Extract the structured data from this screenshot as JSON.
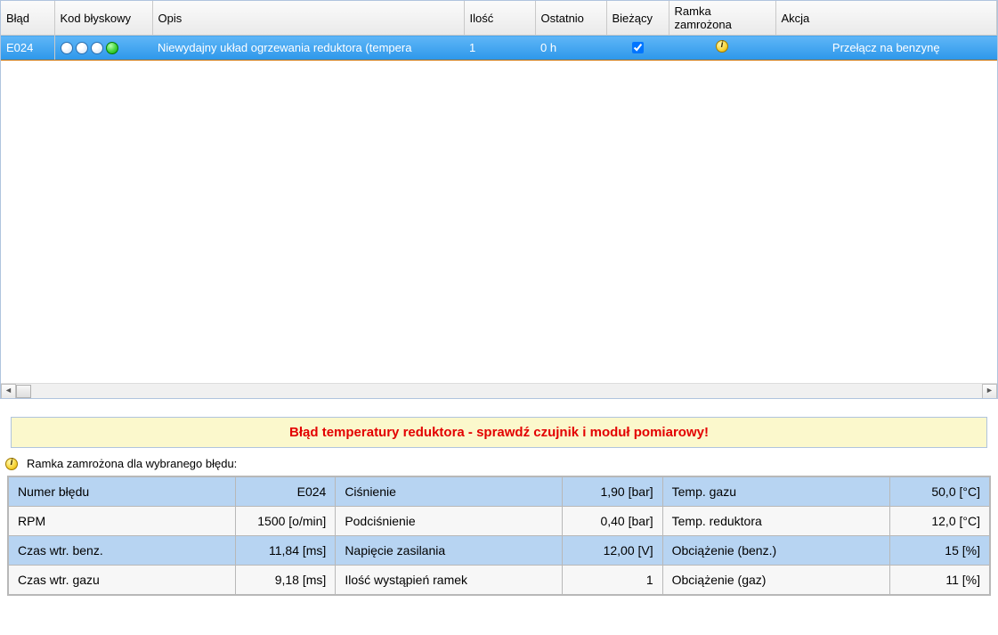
{
  "errorTable": {
    "headers": {
      "blad": "Błąd",
      "kod": "Kod błyskowy",
      "opis": "Opis",
      "ilosc": "Ilość",
      "ostatnio": "Ostatnio",
      "biezacy": "Bieżący",
      "ramka": "Ramka zamrożona",
      "akcja": "Akcja"
    },
    "row": {
      "code": "E024",
      "desc": "Niewydajny układ ogrzewania reduktora (tempera",
      "count": "1",
      "last": "0 h",
      "currentChecked": true,
      "action": "Przełącz na benzynę"
    }
  },
  "warning": "Błąd temperatury reduktora - sprawdź czujnik i moduł pomiarowy!",
  "freezeLabel": "Ramka zamrożona dla wybranego błędu:",
  "freeze": {
    "r1": {
      "a_lab": "Numer błędu",
      "a_val": "E024",
      "b_lab": "Ciśnienie",
      "b_val": "1,90 [bar]",
      "c_lab": "Temp. gazu",
      "c_val": "50,0 [°C]"
    },
    "r2": {
      "a_lab": "RPM",
      "a_val": "1500 [o/min]",
      "b_lab": "Podciśnienie",
      "b_val": "0,40 [bar]",
      "c_lab": "Temp. reduktora",
      "c_val": "12,0 [°C]"
    },
    "r3": {
      "a_lab": "Czas wtr. benz.",
      "a_val": "11,84 [ms]",
      "b_lab": "Napięcie zasilania",
      "b_val": "12,00 [V]",
      "c_lab": "Obciążenie (benz.)",
      "c_val": "15 [%]"
    },
    "r4": {
      "a_lab": "Czas wtr. gazu",
      "a_val": "9,18 [ms]",
      "b_lab": "Ilość wystąpień ramek",
      "b_val": "1",
      "c_lab": "Obciążenie (gaz)",
      "c_val": "11 [%]"
    }
  }
}
